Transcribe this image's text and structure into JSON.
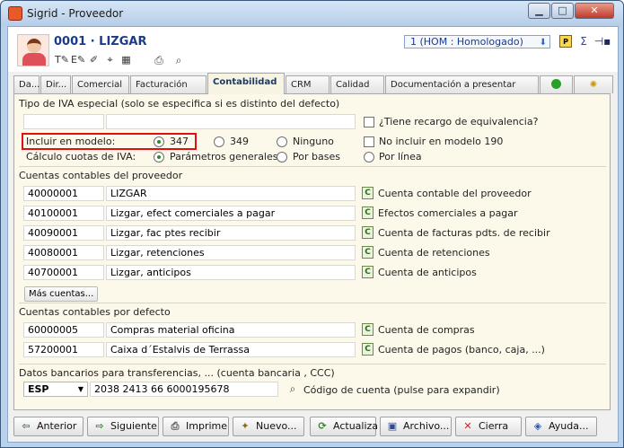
{
  "window": {
    "title": "Sigrid - Proveedor"
  },
  "header": {
    "record_title": "0001 · LIZGAR",
    "status": "1 (HOM : Homologado)",
    "sigma": "Σ",
    "pin": "⊣▪"
  },
  "tabs": [
    {
      "label": "Da..."
    },
    {
      "label": "Dir..."
    },
    {
      "label": "Comercial"
    },
    {
      "label": "Facturación"
    },
    {
      "label": "Contabilidad"
    },
    {
      "label": "CRM"
    },
    {
      "label": "Calidad"
    },
    {
      "label": "Documentación a presentar"
    }
  ],
  "iva": {
    "section_label": "Tipo de IVA especial (solo se especifica si es distinto del defecto)",
    "recargo_label": "¿Tiene recargo de equivalencia?",
    "modelo_label": "Incluir en modelo:",
    "modelo_options": [
      "347",
      "349",
      "Ninguno"
    ],
    "no_incluir_label": "No incluir en modelo 190",
    "calculo_label": "Cálculo cuotas de IVA:",
    "calculo_options": [
      "Parámetros generales",
      "Por bases",
      "Por línea"
    ]
  },
  "cuentas_prov": {
    "section_label": "Cuentas contables del proveedor",
    "rows": [
      {
        "code": "40000001",
        "name": "LIZGAR",
        "desc": "Cuenta contable del proveedor"
      },
      {
        "code": "40100001",
        "name": "Lizgar, efect comerciales a pagar",
        "desc": "Efectos comerciales a pagar"
      },
      {
        "code": "40090001",
        "name": "Lizgar, fac ptes recibir",
        "desc": "Cuenta de facturas pdts. de recibir"
      },
      {
        "code": "40080001",
        "name": "Lizgar, retenciones",
        "desc": "Cuenta de retenciones"
      },
      {
        "code": "40700001",
        "name": "Lizgar, anticipos",
        "desc": "Cuenta de anticipos"
      }
    ],
    "more_button": "Más cuentas..."
  },
  "cuentas_def": {
    "section_label": "Cuentas contables por defecto",
    "rows": [
      {
        "code": "60000005",
        "name": "Compras material oficina",
        "desc": "Cuenta de compras"
      },
      {
        "code": "57200001",
        "name": "Caixa d´Estalvis de Terrassa",
        "desc": "Cuenta de pagos (banco, caja, ...)"
      }
    ]
  },
  "banco": {
    "section_label": "Datos bancarios para transferencias, ... (cuenta bancaria , CCC)",
    "country": "ESP",
    "account": "2038 2413 66 6000195678",
    "codigo_label": "Código de cuenta (pulse para expandir)"
  },
  "buttons": {
    "anterior": "Anterior",
    "siguiente": "Siguiente",
    "imprime": "Imprime",
    "nuevo": "Nuevo...",
    "actualiza": "Actualiza",
    "archivo": "Archivo...",
    "cierra": "Cierra",
    "ayuda": "Ayuda..."
  },
  "colors": {
    "highlight": "#e01010",
    "title_blue": "#1a3a8a",
    "pane_bg": "#fcf9ea"
  }
}
